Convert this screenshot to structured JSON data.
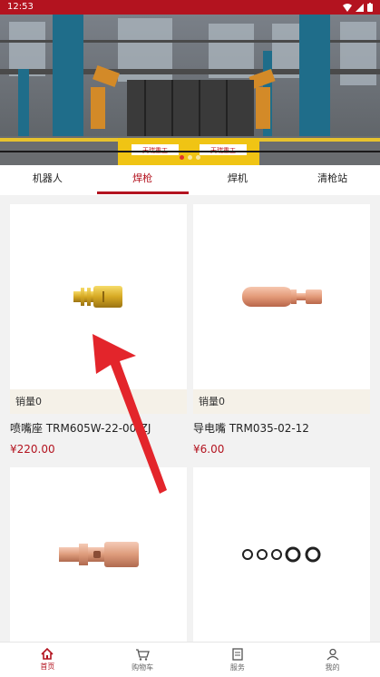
{
  "status_bar": {
    "time": "12:53"
  },
  "banner": {
    "sign_left": "天瑞重工",
    "sign_right": "天瑞重工"
  },
  "tabs": [
    {
      "label": "机器人",
      "active": false
    },
    {
      "label": "焊枪",
      "active": true
    },
    {
      "label": "焊机",
      "active": false
    },
    {
      "label": "清枪站",
      "active": false
    }
  ],
  "products": [
    {
      "sales": "销量0",
      "name": "喷嘴座 TRM605W-22-00-ZJ",
      "price": "¥220.00",
      "icon": "brass-nozzle-holder"
    },
    {
      "sales": "销量0",
      "name": "导电嘴 TRM035-02-12",
      "price": "¥6.00",
      "icon": "copper-contact-tip"
    },
    {
      "sales": "",
      "name": "",
      "price": "",
      "icon": "copper-tip-holder"
    },
    {
      "sales": "",
      "name": "",
      "price": "",
      "icon": "o-rings"
    }
  ],
  "bottom_nav": [
    {
      "label": "首页",
      "icon": "home-icon",
      "active": true
    },
    {
      "label": "购物车",
      "icon": "cart-icon",
      "active": false
    },
    {
      "label": "服务",
      "icon": "service-icon",
      "active": false
    },
    {
      "label": "我的",
      "icon": "user-icon",
      "active": false
    }
  ],
  "colors": {
    "brand": "#b3131f",
    "sales_bg": "#f5f1e8",
    "page_bg": "#f2f2f2"
  }
}
